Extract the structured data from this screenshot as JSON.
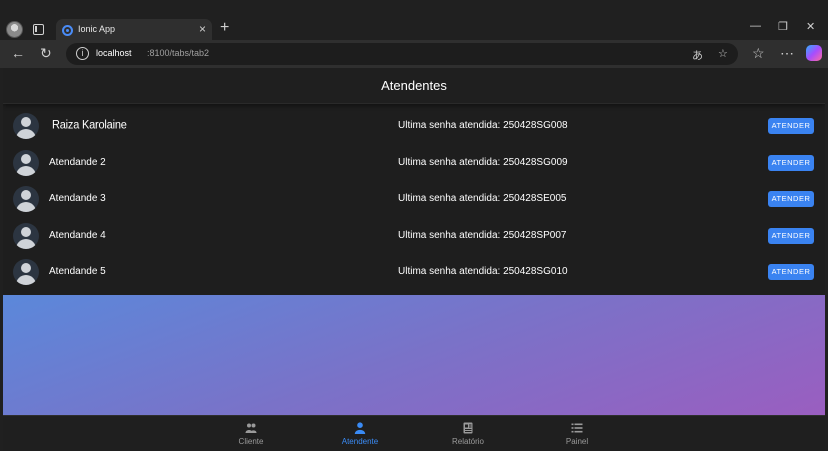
{
  "browser": {
    "tab_title": "Ionic App",
    "tab_close": "×",
    "new_tab": "+",
    "url_host": "localhost",
    "url_path": ":8100/tabs/tab2",
    "window_minimize": "—",
    "window_restore": "❐",
    "window_close": "✕"
  },
  "header": {
    "title": "Atendentes"
  },
  "attendants": [
    {
      "name": "Raiza Karolaine",
      "senha": "Ultima senha atendida: 250428SG008",
      "button": "ATENDER"
    },
    {
      "name": "Atendande 2",
      "senha": "Ultima senha atendida: 250428SG009",
      "button": "ATENDER"
    },
    {
      "name": "Atendande 3",
      "senha": "Ultima senha atendida: 250428SE005",
      "button": "ATENDER"
    },
    {
      "name": "Atendande 4",
      "senha": "Ultima senha atendida: 250428SP007",
      "button": "ATENDER"
    },
    {
      "name": "Atendande 5",
      "senha": "Ultima senha atendida: 250428SG010",
      "button": "ATENDER"
    }
  ],
  "tabs": [
    {
      "label": "Cliente",
      "icon": "people-icon",
      "active": false
    },
    {
      "label": "Atendente",
      "icon": "person-icon",
      "active": true
    },
    {
      "label": "Relatório",
      "icon": "newspaper-icon",
      "active": false
    },
    {
      "label": "Painel",
      "icon": "list-icon",
      "active": false
    }
  ],
  "colors": {
    "accent": "#3a83f1",
    "gradient_start": "#5b88da",
    "gradient_end": "#9a5ec0"
  }
}
